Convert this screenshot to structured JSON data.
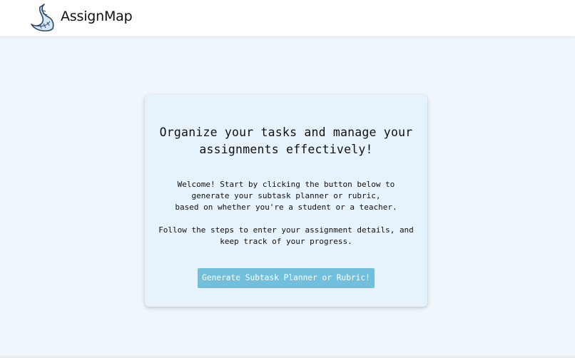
{
  "header": {
    "brand": "AssignMap",
    "logo_icon": "crescent-moon-logo-icon"
  },
  "card": {
    "title_line1": "Organize your tasks and manage your",
    "title_line2": "assignments effectively!",
    "para1_line1": "Welcome! Start by clicking the button below to",
    "para1_line2": "generate your subtask planner or rubric,",
    "para1_line3": "based on whether you're a student or a teacher.",
    "para2_line1": "Follow the steps to enter your assignment details, and",
    "para2_line2": "keep track of your progress.",
    "cta_label": "Generate Subtask Planner or Rubric!"
  },
  "colors": {
    "page_bg": "#eff6fc",
    "card_bg": "#e6f3fc",
    "button_bg": "#72bfdd",
    "button_text": "#ffffff"
  }
}
